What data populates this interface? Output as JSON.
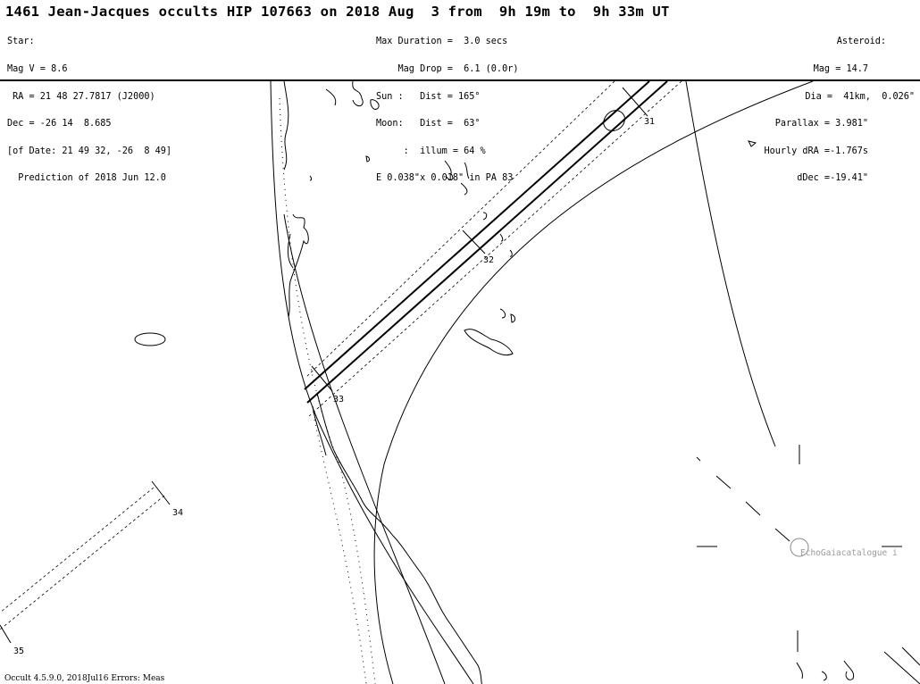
{
  "header": {
    "title": "1461 Jean-Jacques occults HIP 107663 on 2018 Aug  3 from  9h 19m to  9h 33m UT",
    "left": [
      "Star:",
      "Mag V = 8.6",
      " RA = 21 48 27.7817 (J2000)",
      "Dec = -26 14  8.685",
      "[of Date: 21 49 32, -26  8 49]",
      "  Prediction of 2018 Jun 12.0"
    ],
    "center": [
      "Max Duration =  3.0 secs",
      "    Mag Drop =  6.1 (0.0r)",
      "Sun :   Dist = 165°",
      "Moon:   Dist =  63°",
      "     :  illum = 64 %",
      "E 0.038\"x 0.018\" in PA 83"
    ],
    "right": [
      "Asteroid:",
      "Mag = 14.7",
      "Dia =  41km,  0.026\"",
      "Parallax = 3.981\"",
      "Hourly dRA =-1.767s",
      "dDec =-19.41\""
    ]
  },
  "map": {
    "time_labels": [
      "31",
      "32",
      "33",
      "34",
      "35"
    ],
    "path_color": "#000000"
  },
  "footer": {
    "version": "Occult 4.5.9.0, 2018Jul16 Errors: Meas"
  },
  "watermark": "EchoGaiacatalogue i"
}
